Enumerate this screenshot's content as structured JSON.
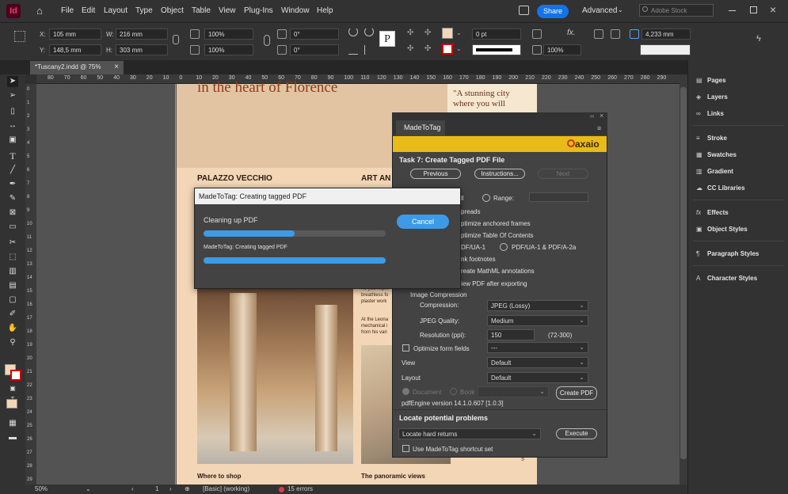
{
  "menubar": {
    "logo": "Id",
    "items": [
      "File",
      "Edit",
      "Layout",
      "Type",
      "Object",
      "Table",
      "View",
      "Plug-Ins",
      "Window",
      "Help"
    ],
    "share": "Share",
    "workspace": "Advanced",
    "search_placeholder": "Adobe Stock"
  },
  "control": {
    "x_label": "X:",
    "x_value": "105 mm",
    "y_label": "Y:",
    "y_value": "148,5 mm",
    "w_label": "W:",
    "w_value": "216 mm",
    "h_label": "H:",
    "h_value": "303 mm",
    "scale_x": "100%",
    "scale_y": "100%",
    "rotate": "0°",
    "shear": "0°",
    "stroke_weight": "0 pt",
    "opacity": "100%",
    "gap": "4,233 mm"
  },
  "tab": {
    "title": "*Tuscany2.indd @ 75%",
    "close": "×"
  },
  "ruler": {
    "ticks": [
      "80",
      "70",
      "60",
      "50",
      "40",
      "30",
      "20",
      "10",
      "0",
      "10",
      "20",
      "30",
      "40",
      "50",
      "60",
      "70",
      "80",
      "90",
      "100",
      "110",
      "120",
      "130",
      "140",
      "150",
      "160",
      "170",
      "180",
      "190",
      "200",
      "210",
      "220",
      "230",
      "240",
      "250",
      "260",
      "270",
      "280",
      "290"
    ],
    "vticks": [
      "0",
      "1",
      "2",
      "3",
      "4",
      "5",
      "6",
      "7",
      "8",
      "9",
      "10",
      "11",
      "12",
      "13",
      "14",
      "15",
      "16",
      "17",
      "18",
      "19",
      "20",
      "21",
      "22",
      "23",
      "24",
      "25",
      "26",
      "27",
      "28",
      "29"
    ]
  },
  "document": {
    "headline": "in the heart of Florence",
    "quote": "\"A stunning city where you will",
    "h_left": "PALAZZO VECCHIO",
    "h_right": "ART AN",
    "body1": "As you impre breathless fo plaster work",
    "body2": "At the Leona mechanical i from his vari",
    "cap_left": "Where to shop",
    "cap_right": "The panoramic views",
    "side": "vent.com"
  },
  "status": {
    "zoom": "50%",
    "page": "1",
    "style": "[Basic] (working)",
    "errors": "15 errors"
  },
  "rpanel": {
    "items": [
      {
        "icon": "▤",
        "label": "Pages"
      },
      {
        "icon": "◈",
        "label": "Layers"
      },
      {
        "icon": "∞",
        "label": "Links"
      },
      {
        "icon": "≡",
        "label": "Stroke"
      },
      {
        "icon": "▦",
        "label": "Swatches"
      },
      {
        "icon": "▥",
        "label": "Gradient"
      },
      {
        "icon": "☁",
        "label": "CC Libraries"
      },
      {
        "icon": "fx",
        "label": "Effects"
      },
      {
        "icon": "▣",
        "label": "Object Styles"
      },
      {
        "icon": "¶",
        "label": "Paragraph Styles"
      },
      {
        "icon": "A",
        "label": "Character Styles"
      }
    ]
  },
  "madetotag": {
    "tab": "MadeToTag",
    "brand": "axaio",
    "task": "Task 7: Create Tagged PDF File",
    "prev": "Previous",
    "instructions": "Instructions...",
    "next": "Next",
    "range_label": "Range:",
    "all": "ll",
    "opts": [
      "preads",
      "ptimize anchored frames",
      "ptimize Table Of Contents"
    ],
    "pdfua": "DF/UA-1",
    "pdfua_a": "PDF/UA-1 & PDF/A-2a",
    "more": [
      "nk footnotes",
      "reate MathML annotations",
      "iew PDF after exporting"
    ],
    "img_comp": "Image Compression",
    "compression_label": "Compression:",
    "compression": "JPEG (Lossy)",
    "quality_label": "JPEG Quality:",
    "quality": "Medium",
    "res_label": "Resolution (ppi):",
    "res": "150",
    "res_range": "(72-300)",
    "form_fields": "Optimize form fields",
    "form_value": "---",
    "view_label": "View",
    "view_value": "Default",
    "layout_label": "Layout",
    "layout_value": "Default",
    "document": "Document",
    "book": "Book",
    "create": "Create PDF",
    "engine": "pdfEngine version 14.1.0.607 [1.0.3]",
    "locate": "Locate potential problems",
    "locate_value": "Locate hard returns",
    "execute": "Execute",
    "shortcut": "Use MadeToTag shortcut set"
  },
  "progress": {
    "title": "MadeToTag: Creating tagged PDF",
    "step": "Cleaning up PDF",
    "p1": 0.5,
    "sub": "MadeToTag: Creating tagged PDF",
    "p2": 1.0,
    "cancel": "Cancel"
  },
  "colors": {
    "accent": "#3b9be8",
    "brand": "#e8bb18",
    "chrome": "#323232"
  }
}
